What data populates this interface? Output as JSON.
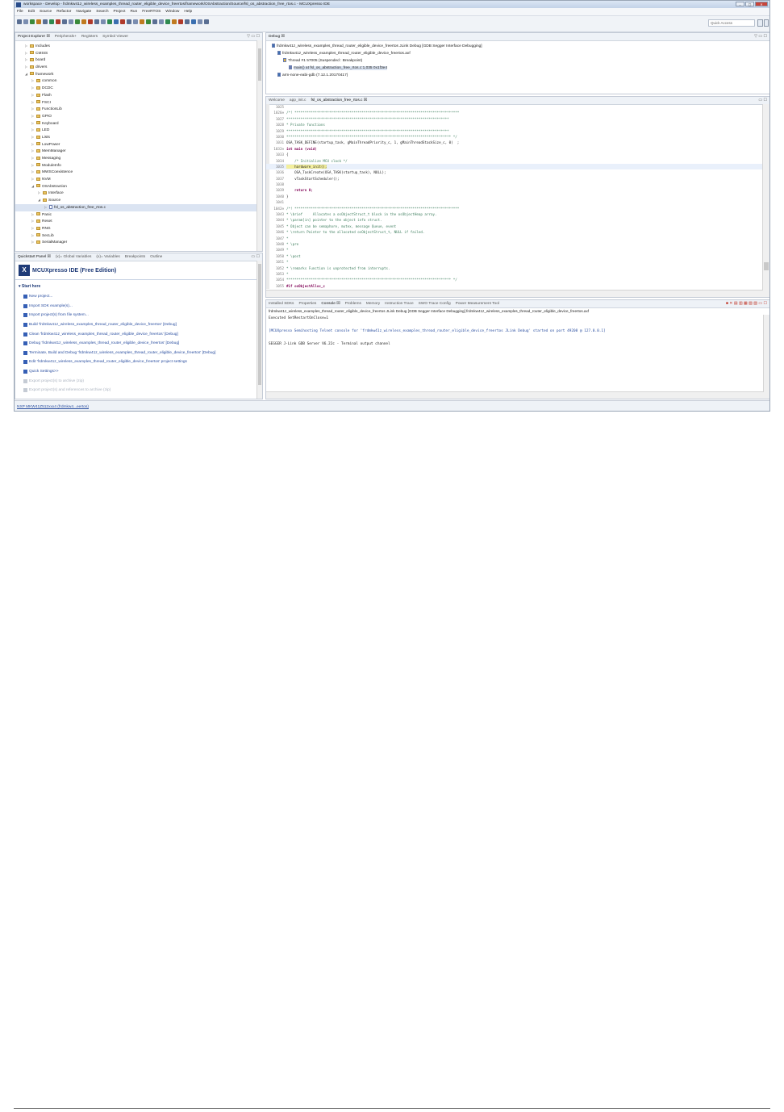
{
  "window": {
    "title": "workspace - Develop - frdmkw41z_wireless_examples_thread_router_eligible_device_freertos/framework/OSAbstraction/Source/fsl_os_abstraction_free_rtos.c - MCUXpresso IDE",
    "controls": [
      "–",
      "▢",
      "✕"
    ]
  },
  "menu": [
    "File",
    "Edit",
    "Source",
    "Refactor",
    "Navigate",
    "Search",
    "Project",
    "Run",
    "FreeRTOS",
    "Window",
    "Help"
  ],
  "toolbar": {
    "quick_access": "Quick Access"
  },
  "project_explorer": {
    "tabs": [
      "Project Explorer ☒",
      "Peripherals+",
      "Registers",
      "Symbol Viewer"
    ],
    "items": [
      {
        "label": "Includes",
        "indent": 1,
        "arrow": "▷",
        "type": "folder"
      },
      {
        "label": "CMSIS",
        "indent": 1,
        "arrow": "▷",
        "type": "folder"
      },
      {
        "label": "board",
        "indent": 1,
        "arrow": "▷",
        "type": "folder"
      },
      {
        "label": "drivers",
        "indent": 1,
        "arrow": "▷",
        "type": "folder"
      },
      {
        "label": "framework",
        "indent": 1,
        "arrow": "◢",
        "type": "folder"
      },
      {
        "label": "common",
        "indent": 2,
        "arrow": "▷",
        "type": "folder"
      },
      {
        "label": "DCDC",
        "indent": 2,
        "arrow": "▷",
        "type": "folder"
      },
      {
        "label": "Flash",
        "indent": 2,
        "arrow": "▷",
        "type": "folder"
      },
      {
        "label": "FSCI",
        "indent": 2,
        "arrow": "▷",
        "type": "folder"
      },
      {
        "label": "FunctionLib",
        "indent": 2,
        "arrow": "▷",
        "type": "folder"
      },
      {
        "label": "GPIO",
        "indent": 2,
        "arrow": "▷",
        "type": "folder"
      },
      {
        "label": "Keyboard",
        "indent": 2,
        "arrow": "▷",
        "type": "folder"
      },
      {
        "label": "LED",
        "indent": 2,
        "arrow": "▷",
        "type": "folder"
      },
      {
        "label": "Lists",
        "indent": 2,
        "arrow": "▷",
        "type": "folder"
      },
      {
        "label": "LowPower",
        "indent": 2,
        "arrow": "▷",
        "type": "folder"
      },
      {
        "label": "MemManager",
        "indent": 2,
        "arrow": "▷",
        "type": "folder"
      },
      {
        "label": "Messaging",
        "indent": 2,
        "arrow": "▷",
        "type": "folder"
      },
      {
        "label": "ModuleInfo",
        "indent": 2,
        "arrow": "▷",
        "type": "folder"
      },
      {
        "label": "MWSCoexistence",
        "indent": 2,
        "arrow": "▷",
        "type": "folder"
      },
      {
        "label": "NVM",
        "indent": 2,
        "arrow": "▷",
        "type": "folder"
      },
      {
        "label": "OSAbstraction",
        "indent": 2,
        "arrow": "◢",
        "type": "folder"
      },
      {
        "label": "Interface",
        "indent": 3,
        "arrow": "▷",
        "type": "folder"
      },
      {
        "label": "Source",
        "indent": 3,
        "arrow": "◢",
        "type": "folder"
      },
      {
        "label": "fsl_os_abstraction_free_rtos.c",
        "indent": 4,
        "arrow": "▷",
        "type": "file",
        "selected": true
      },
      {
        "label": "Panic",
        "indent": 2,
        "arrow": "▷",
        "type": "folder"
      },
      {
        "label": "Reset",
        "indent": 2,
        "arrow": "▷",
        "type": "folder"
      },
      {
        "label": "RNG",
        "indent": 2,
        "arrow": "▷",
        "type": "folder"
      },
      {
        "label": "SecLib",
        "indent": 2,
        "arrow": "▷",
        "type": "folder"
      },
      {
        "label": "SerialManager",
        "indent": 2,
        "arrow": "▷",
        "type": "folder"
      }
    ]
  },
  "quickstart": {
    "tabs": [
      "Quickstart Panel ☒",
      "(x)= Global Variables",
      "(x)= Variables",
      "Breakpoints",
      "Outline"
    ],
    "title": "MCUXpresso IDE (Free Edition)",
    "section": "▾ Start here",
    "items": [
      {
        "label": "New project...",
        "enabled": true
      },
      {
        "label": "Import SDK example(s)...",
        "enabled": true
      },
      {
        "label": "Import project(s) from file system...",
        "enabled": true
      },
      {
        "label": "Build 'frdmkw41z_wireless_examples_thread_router_eligible_device_freertos' [Debug]",
        "enabled": true
      },
      {
        "label": "Clean 'frdmkw41z_wireless_examples_thread_router_eligible_device_freertos' [Debug]",
        "enabled": true
      },
      {
        "label": "Debug 'frdmkw41z_wireless_examples_thread_router_eligible_device_freertos' [Debug]",
        "enabled": true
      },
      {
        "label": "Terminate, Build and Debug 'frdmkw41z_wireless_examples_thread_router_eligible_device_freertos' [Debug]",
        "enabled": true
      },
      {
        "label": "Edit 'frdmkw41z_wireless_examples_thread_router_eligible_device_freertos' project settings",
        "enabled": true
      },
      {
        "label": "Quick Settings>>",
        "enabled": true
      },
      {
        "label": "Export project(s) to archive (zip)",
        "enabled": false
      },
      {
        "label": "Export project(s) and references to archive (zip)",
        "enabled": false
      }
    ]
  },
  "debug": {
    "tab": "Debug ☒",
    "rows": [
      {
        "text": "frdmkw41z_wireless_examples_thread_router_eligible_device_freertos JLink Debug [GDB Segger Interface Debugging]",
        "indent": 1
      },
      {
        "text": "frdmkw41z_wireless_examples_thread_router_eligible_device_freertos.axf",
        "indent": 2
      },
      {
        "text": "Thread #1 57005 (Suspended : Breakpoint)",
        "indent": 3
      },
      {
        "text": "main() at fsl_os_abstraction_free_rtos.c:1,035 0x1f3e4",
        "indent": 4
      },
      {
        "text": "arm-none-eabi-gdb (7.12.1.20170417)",
        "indent": 2
      }
    ]
  },
  "editor": {
    "tabs": [
      "Welcome",
      "app_init.c",
      "fsl_os_abstraction_free_rtos.c ☒"
    ],
    "current_line": 1035,
    "lines": [
      {
        "n": "1025",
        "t": ""
      },
      {
        "n": "1026⊖",
        "t": "/*! *********************************************************************************"
      },
      {
        "n": "1027",
        "t": "********************************************************************************"
      },
      {
        "n": "1028",
        "t": "* Private functions"
      },
      {
        "n": "1029",
        "t": "********************************************************************************"
      },
      {
        "n": "1030",
        "t": "********************************************************************************* */"
      },
      {
        "n": "1031",
        "t": "OSA_TASK_DEFINE(startup_task, gMainThreadPriority_c, 1, gMainThreadStackSize_c, 0)  ;"
      },
      {
        "n": "1032⊖",
        "t": "int main (void)"
      },
      {
        "n": "1033",
        "t": "{"
      },
      {
        "n": "1034",
        "t": "    /* Initialize MCU clock */"
      },
      {
        "n": "1035",
        "t": "    hardware_init();"
      },
      {
        "n": "1036",
        "t": "    OSA_TaskCreate(OSA_TASK(startup_task), NULL);"
      },
      {
        "n": "1037",
        "t": "    vTaskStartScheduler();"
      },
      {
        "n": "1038",
        "t": ""
      },
      {
        "n": "1039",
        "t": "    return 0;"
      },
      {
        "n": "1040",
        "t": "}"
      },
      {
        "n": "1041",
        "t": ""
      },
      {
        "n": "1042⊖",
        "t": "/*! *********************************************************************************"
      },
      {
        "n": "1043",
        "t": "* \\brief     Allocates a osObjectStruct_t block in the osObjectHeap array."
      },
      {
        "n": "1044",
        "t": "* \\param[in] pointer to the object info struct."
      },
      {
        "n": "1045",
        "t": "* Object can be semaphore, mutex, message Queue, event"
      },
      {
        "n": "1046",
        "t": "* \\return Pointer to the allocated osObjectStruct_t, NULL if failed."
      },
      {
        "n": "1047",
        "t": "*"
      },
      {
        "n": "1048",
        "t": "* \\pre"
      },
      {
        "n": "1049",
        "t": "*"
      },
      {
        "n": "1050",
        "t": "* \\post"
      },
      {
        "n": "1051",
        "t": "*"
      },
      {
        "n": "1052",
        "t": "* \\remarks Function is unprotected from interrupts."
      },
      {
        "n": "1053",
        "t": "*"
      },
      {
        "n": "1054",
        "t": "********************************************************************************* */"
      },
      {
        "n": "1055",
        "t": "#if osObjectAlloc_c"
      }
    ]
  },
  "console": {
    "tabs": [
      "Installed SDKs",
      "Properties",
      "Console ☒",
      "Problems",
      "Memory",
      "Instruction Trace",
      "SWO Trace Config",
      "Power Measurement Tool"
    ],
    "session": "frdmkw41z_wireless_examples_thread_router_eligible_device_freertos JLink Debug [GDB Segger Interface Debugging] frdmkw41z_wireless_examples_thread_router_eligible_device_freertos.axf",
    "lines": [
      "Executed SetRestartOnClose=1",
      "",
      "[MCUXpresso Semihosting Telnet console for 'frdmkw41z_wireless_examples_thread_router_eligible_device_freertos JLink Debug' started on port 49208 @ 127.0.0.1]",
      "",
      "SEGGER J-Link GDB Server V6.22c - Terminal output channel"
    ]
  },
  "status": {
    "text": "NXP MKW41Z512xxx4 (frdmkw4...eertos)"
  },
  "colors": {
    "accent": "#1f3b78",
    "link": "#2b4fa0",
    "comment": "#3f7f5f",
    "keyword": "#7f0055",
    "current_line": "#f3ef9c"
  }
}
